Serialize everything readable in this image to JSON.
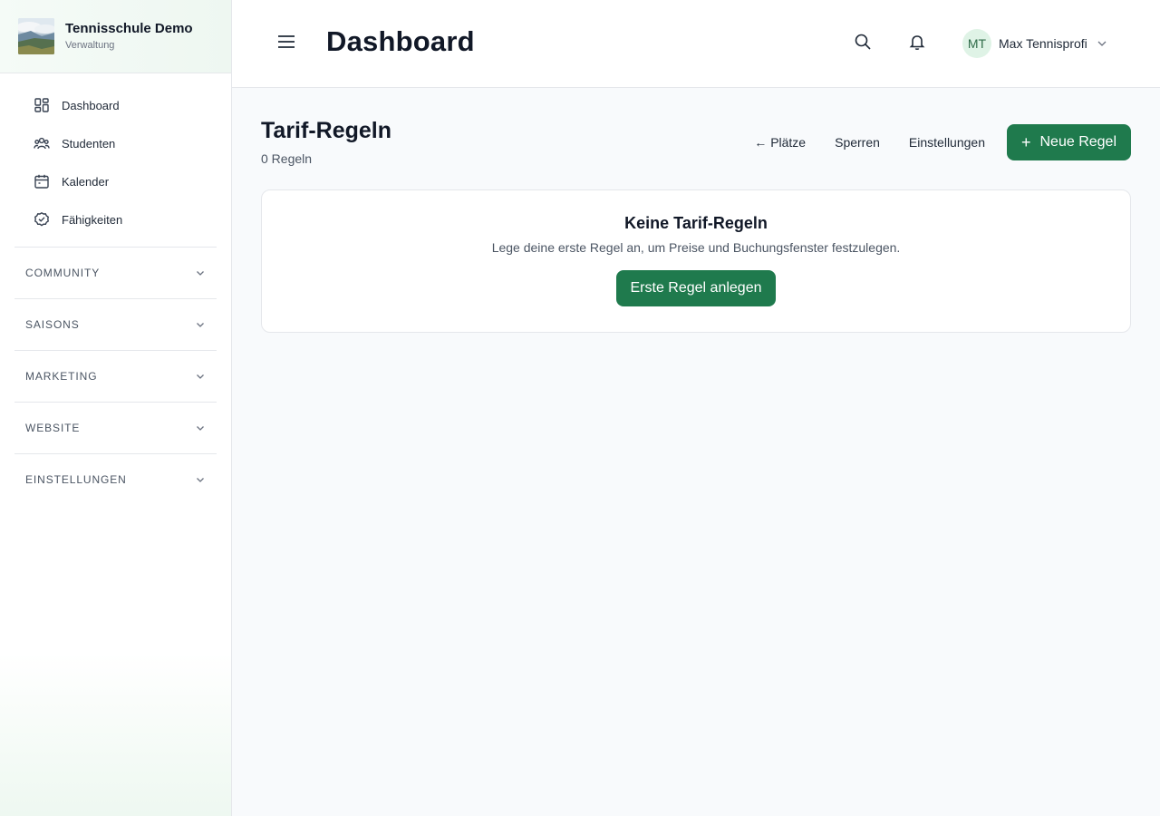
{
  "brand": {
    "title": "Tennisschule Demo",
    "subtitle": "Verwaltung"
  },
  "sidebar": {
    "items": [
      {
        "label": "Dashboard",
        "icon": "dashboard-icon"
      },
      {
        "label": "Studenten",
        "icon": "users-icon"
      },
      {
        "label": "Kalender",
        "icon": "calendar-icon"
      },
      {
        "label": "Fähigkeiten",
        "icon": "check-circle-icon"
      }
    ],
    "sections": [
      {
        "label": "COMMUNITY"
      },
      {
        "label": "SAISONS"
      },
      {
        "label": "MARKETING"
      },
      {
        "label": "WEBSITE"
      },
      {
        "label": "EINSTELLUNGEN"
      }
    ]
  },
  "header": {
    "title": "Dashboard",
    "user": {
      "initials": "MT",
      "name": "Max Tennisprofi"
    }
  },
  "page": {
    "title": "Tarif-Regeln",
    "count": "0 Regeln",
    "actions": {
      "back": "Plätze",
      "back_arrow": "←",
      "blocks": "Sperren",
      "settings": "Einstellungen",
      "new_rule": "Neue Regel",
      "new_rule_plus": "+"
    }
  },
  "empty_state": {
    "title": "Keine Tarif-Regeln",
    "description": "Lege deine erste Regel an, um Preise und Buchungsfenster festzulegen.",
    "cta": "Erste Regel anlegen"
  },
  "colors": {
    "primary": "#1f7a4d",
    "avatar_bg": "#dff3e6",
    "avatar_text": "#2f6b48"
  }
}
